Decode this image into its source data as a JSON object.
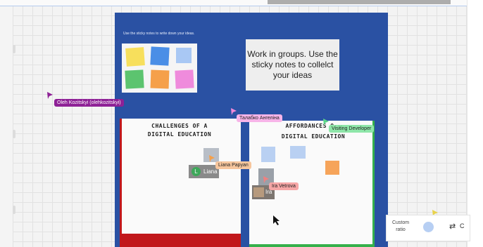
{
  "board": {
    "instruction": "Use the sticky notes to write down your ideas.",
    "work_card": "Work in groups. Use the sticky notes to collelct your ideas"
  },
  "sticky_palette": {
    "colors": [
      "#f7df5c",
      "#4a8ee6",
      "#a9c8f4",
      "#5cc46f",
      "#f5a04a",
      "#ef8bdc"
    ]
  },
  "frames": {
    "challenges_title": "CHALLENGES OF A DIGITAL EDUCATION",
    "affordances_title": "AFFORDANCES OF DIGITAL EDUCATION",
    "afford_title_line1": "AFFORDANCES O",
    "afford_title_line2": "DIGITAL EDUCATION"
  },
  "collaborators": [
    {
      "name": "Oleh Kozitskyi (olehkozitskyi)",
      "color": "#8e2196"
    },
    {
      "name": "Талабко Ангеліна",
      "color": "#f28ad9"
    },
    {
      "name": "Visiting Developer",
      "color": "#5cd68a"
    },
    {
      "name": "Liana Papyan",
      "color": "#f7c69d"
    },
    {
      "name": "Ira Vetrova",
      "color": "#f6a6a6"
    }
  ],
  "avatars": [
    {
      "initial": "L",
      "name": "Liana"
    },
    {
      "name": "Ira"
    }
  ],
  "ratio_panel": {
    "label": "Custom ratio",
    "swap_label": "C"
  }
}
